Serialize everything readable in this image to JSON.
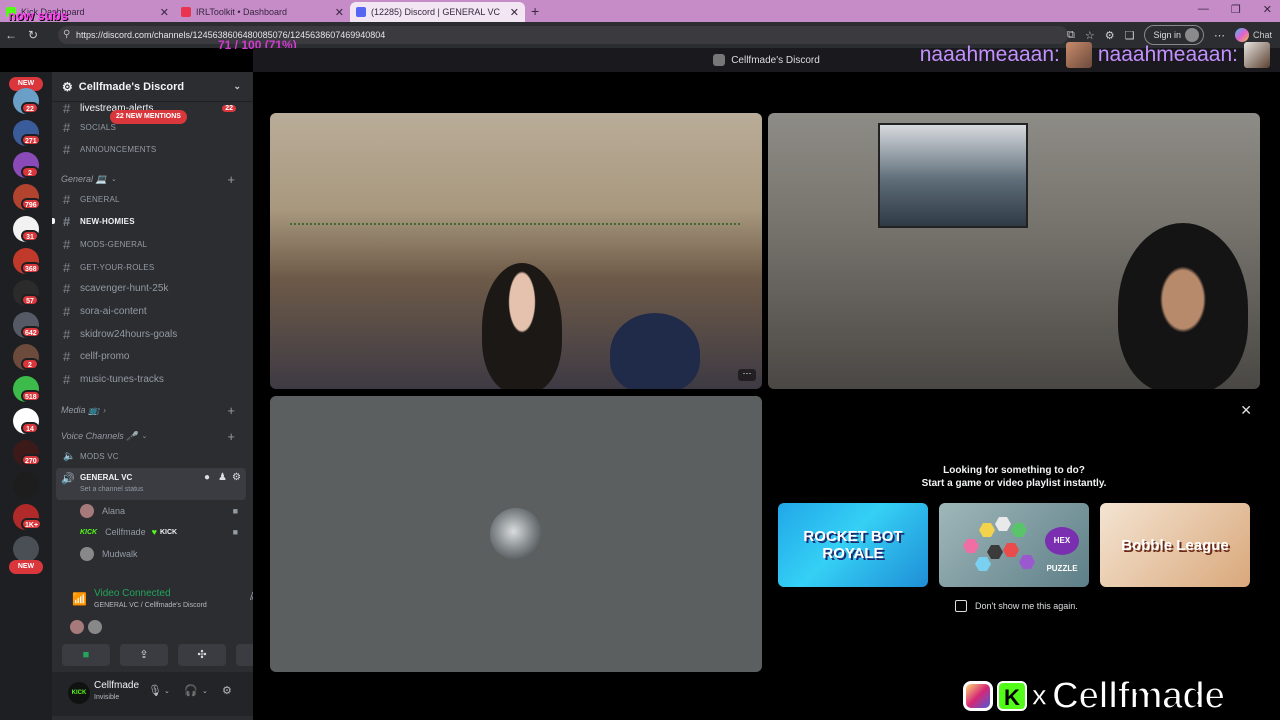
{
  "overlay": {
    "top_left": "now subs",
    "progress": "71 / 100 (71%)",
    "top_right_name_1": "naaahmeaaan:",
    "top_right_name_2": "naaahmeaaan:",
    "brand_x": "x",
    "brand_name": "Cellfmade"
  },
  "browser": {
    "tabs": [
      {
        "title": "Kick Dashboard",
        "favicon_color": "#53fc18"
      },
      {
        "title": "IRLToolkit • Dashboard",
        "favicon_color": "#e8344e"
      },
      {
        "title": "(12285) Discord | GENERAL VC",
        "favicon_color": "#5865f2"
      }
    ],
    "url": "https://discord.com/channels/1245638606480085076/1245638607469940804",
    "sign_in": "Sign in",
    "chat": "Chat"
  },
  "topbar": {
    "server_name": "Cellfmade's Discord"
  },
  "servers": {
    "new_top": "NEW",
    "new_bottom": "NEW",
    "badges": [
      "22",
      "271",
      "2",
      "796",
      "31",
      "368",
      "57",
      "642",
      "2",
      "518",
      "14",
      "270",
      "1K+"
    ]
  },
  "sidebar": {
    "server_title": "Cellfmade's Discord",
    "mentions_pill": "22 NEW MENTIONS",
    "partial_channel": "livestream-alerts",
    "partial_badge": "22",
    "channels": [
      {
        "name": "SOCIALS"
      },
      {
        "name": "ANNOUNCEMENTS"
      },
      {
        "name": "GENERAL"
      },
      {
        "name": "NEW-HOMIES"
      },
      {
        "name": "MODS-GENERAL"
      },
      {
        "name": "GET-YOUR-ROLES"
      },
      {
        "name": "scavenger-hunt-25k"
      },
      {
        "name": "sora-ai-content"
      },
      {
        "name": "skidrow24hours-goals"
      },
      {
        "name": "cellf-promo"
      },
      {
        "name": "music-tunes-tracks"
      }
    ],
    "categories": {
      "general": "General 💻",
      "media": "Media 📺",
      "voice": "Voice Channels 🎤"
    },
    "mods_vc": "MODS VC",
    "general_vc": "GENERAL VC",
    "channel_status": "Set a channel status",
    "voice_users": [
      {
        "name": "Alana",
        "tag": ""
      },
      {
        "name": "Cellfmade",
        "tag": "KICK"
      },
      {
        "name": "Mudwalk",
        "tag": ""
      }
    ],
    "connection": {
      "status": "Video Connected",
      "location": "GENERAL VC / Cellfmade's Discord"
    },
    "user": {
      "name": "Cellfmade",
      "status": "Invisible",
      "avatar_text": "KICK"
    }
  },
  "promo": {
    "line1": "Looking for something to do?",
    "line2": "Start a game or video playlist instantly.",
    "games": [
      "ROCKET BOT ROYALE",
      "HEX PUZZLE",
      "Bobble League"
    ],
    "dont_show": "Don't show me this again."
  },
  "colors": {
    "accent": "#5865f2",
    "online": "#23a55a",
    "mention": "#da373c",
    "kick": "#53fc18"
  }
}
